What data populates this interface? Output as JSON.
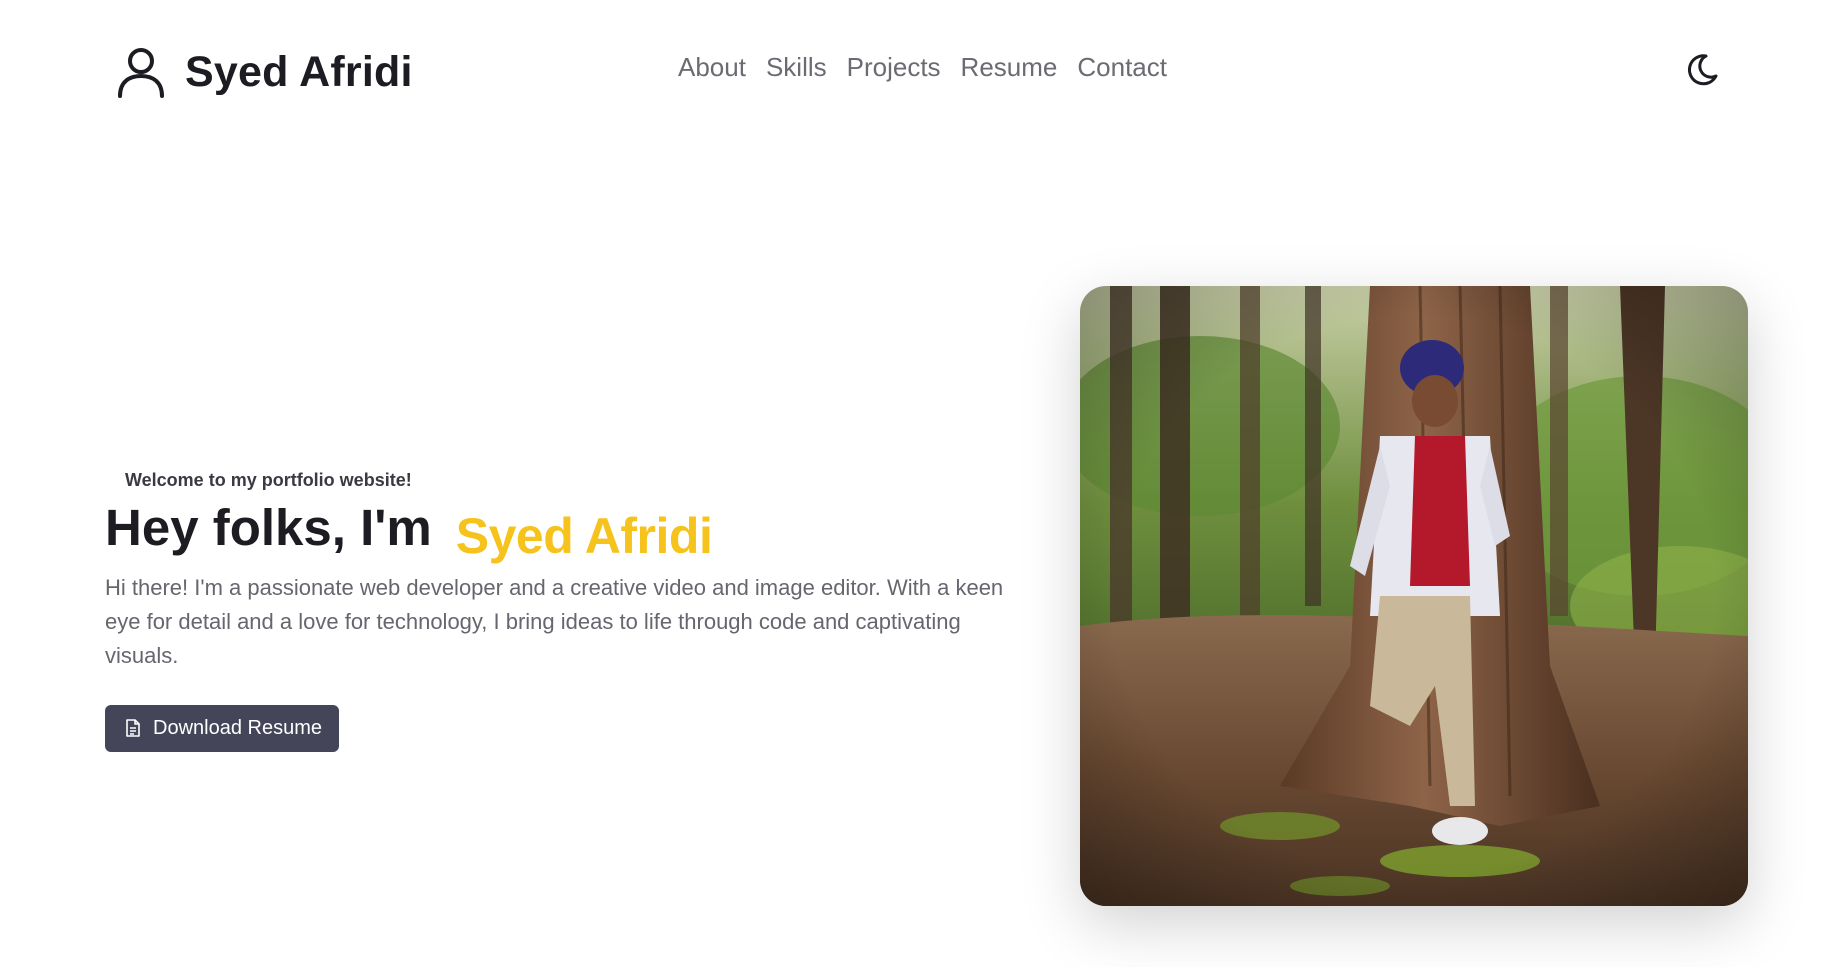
{
  "brand": {
    "name": "Syed Afridi",
    "icon": "user-icon"
  },
  "nav": {
    "items": [
      {
        "label": "About"
      },
      {
        "label": "Skills"
      },
      {
        "label": "Projects"
      },
      {
        "label": "Resume"
      },
      {
        "label": "Contact"
      }
    ]
  },
  "theme_toggle": {
    "icon": "moon-icon"
  },
  "hero": {
    "welcome": "Welcome to my portfolio website!",
    "greeting": "Hey folks, I'm",
    "highlight_name": "Syed Afridi",
    "bio": "Hi there! I'm a passionate web developer and a creative video and image editor. With a keen eye for detail and a love for technology, I bring ideas to life through code and captivating visuals.",
    "cta_label": "Download Resume",
    "cta_icon": "document-icon"
  },
  "colors": {
    "accent": "#f6c21c",
    "button_bg": "#45455a",
    "text_dark": "#1c1c22",
    "text_muted": "#66666e"
  }
}
